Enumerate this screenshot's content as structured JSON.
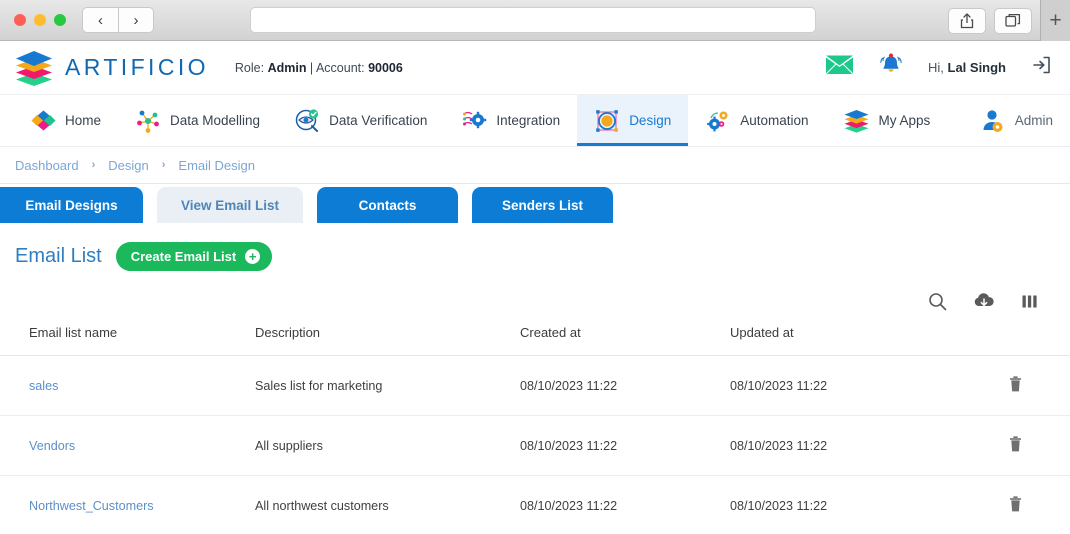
{
  "browser": {
    "back_label": "‹",
    "forward_label": "›",
    "url_value": "",
    "url_placeholder": "",
    "share_icon": "share-icon",
    "tabs_icon": "tabs-icon",
    "newtab_label": "+"
  },
  "header": {
    "logo_icon": "artificio-layers-logo",
    "brand": "ARTIFICIO",
    "role_prefix": "Role: ",
    "role_value": "Admin",
    "account_separator": " | Account: ",
    "account_value": "90006",
    "mail_icon": "envelope-icon",
    "bell_icon": "notification-bell-icon",
    "greeting_prefix": "Hi, ",
    "greeting_name": "Lal Singh",
    "logout_icon": "logout-icon"
  },
  "nav": {
    "items": [
      {
        "label": "Home",
        "icon": "home-diamonds-icon",
        "active": false
      },
      {
        "label": "Data Modelling",
        "icon": "network-nodes-icon",
        "active": false
      },
      {
        "label": "Data Verification",
        "icon": "eye-check-icon",
        "active": false
      },
      {
        "label": "Integration",
        "icon": "integration-gear-icon",
        "active": false
      },
      {
        "label": "Design",
        "icon": "design-canvas-icon",
        "active": true
      },
      {
        "label": "Automation",
        "icon": "automation-gears-icon",
        "active": false
      },
      {
        "label": "My Apps",
        "icon": "layers-stack-icon",
        "active": false
      }
    ],
    "account_label": "Admin",
    "account_icon": "user-gear-icon"
  },
  "breadcrumb": {
    "items": [
      "Dashboard",
      "Design",
      "Email Design"
    ],
    "separator": "›"
  },
  "tabs": [
    {
      "label": "Email Designs",
      "active": false
    },
    {
      "label": "View Email List",
      "active": true
    },
    {
      "label": "Contacts",
      "active": false
    },
    {
      "label": "Senders List",
      "active": false
    }
  ],
  "section": {
    "title": "Email List",
    "create_label": "Create Email List",
    "create_icon": "plus-circle-icon"
  },
  "toolbar": {
    "search_icon": "search-icon",
    "download_icon": "cloud-download-icon",
    "columns_icon": "columns-icon"
  },
  "table": {
    "columns": [
      "Email list name",
      "Description",
      "Created at",
      "Updated at"
    ],
    "delete_icon": "trash-icon",
    "rows": [
      {
        "name": "sales",
        "description": "Sales list for marketing",
        "created_at": "08/10/2023 11:22",
        "updated_at": "08/10/2023 11:22"
      },
      {
        "name": "Vendors",
        "description": "All suppliers",
        "created_at": "08/10/2023 11:22",
        "updated_at": "08/10/2023 11:22"
      },
      {
        "name": "Northwest_Customers",
        "description": "All northwest customers",
        "created_at": "08/10/2023 11:22",
        "updated_at": "08/10/2023 11:22"
      }
    ]
  },
  "colors": {
    "brand_blue": "#1068b3",
    "tab_blue": "#0d7cd4",
    "active_nav_bg": "#eaf3fc",
    "green": "#1cb85c",
    "link_blue": "#5b8fc9",
    "breadcrumb_blue": "#7ba7d6"
  }
}
